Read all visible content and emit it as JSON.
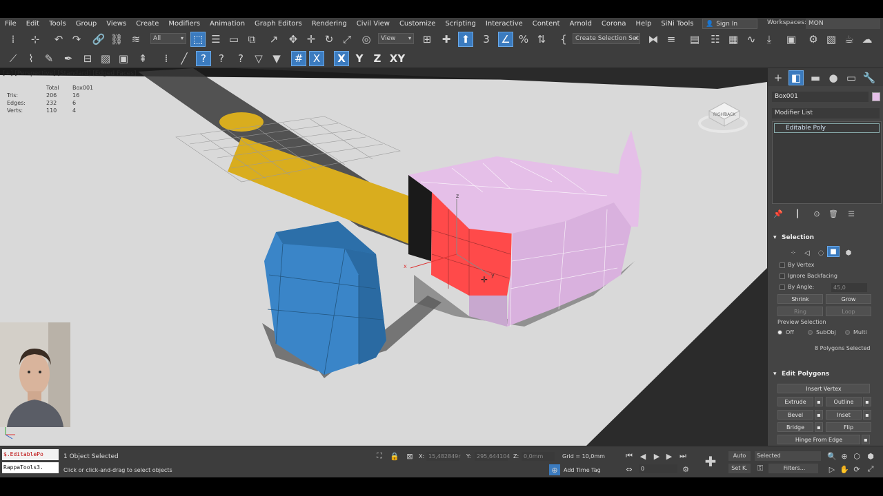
{
  "menubar": {
    "items": [
      "File",
      "Edit",
      "Tools",
      "Group",
      "Views",
      "Create",
      "Modifiers",
      "Animation",
      "Graph Editors",
      "Rendering",
      "Civil View",
      "Customize",
      "Scripting",
      "Interactive",
      "Content",
      "Arnold",
      "Corona",
      "Help",
      "SiNi Tools"
    ],
    "signin_label": "Sign In",
    "workspaces_label": "Workspaces:",
    "workspace_value": "MON"
  },
  "toolbar": {
    "filter_value": "All",
    "refcoord_value": "View",
    "selection_set_value": "Create Selection Set",
    "axis_x": "X",
    "axis_y": "Y",
    "axis_z": "Z",
    "axis_xy": "XY"
  },
  "viewport": {
    "label": "[+] [Perspective] [Standard] [Edged Faces]",
    "stats": {
      "header_total": "Total",
      "header_object": "Box001",
      "rows": [
        {
          "label": "Tris:",
          "total": "206",
          "object": "16"
        },
        {
          "label": "Edges:",
          "total": "232",
          "object": "6"
        },
        {
          "label": "Verts:",
          "total": "110",
          "object": "4"
        }
      ]
    },
    "gizmo": {
      "z": "z",
      "y": "y",
      "x": "x"
    },
    "viewcube": {
      "front": "BACK",
      "side": "RIGHT"
    }
  },
  "command_panel": {
    "object_name": "Box001",
    "modifier_list_label": "Modifier List",
    "stack_item": "Editable Poly",
    "selection": {
      "title": "Selection",
      "by_vertex": "By Vertex",
      "ignore_backfacing": "Ignore Backfacing",
      "by_angle": "By Angle:",
      "by_angle_value": "45,0",
      "shrink": "Shrink",
      "grow": "Grow",
      "ring": "Ring",
      "loop": "Loop",
      "preview_label": "Preview Selection",
      "preview_off": "Off",
      "preview_subobj": "SubObj",
      "preview_multi": "Multi",
      "selected_count": "8 Polygons Selected"
    },
    "edit_polygons": {
      "title": "Edit Polygons",
      "insert_vertex": "Insert Vertex",
      "extrude": "Extrude",
      "outline": "Outline",
      "bevel": "Bevel",
      "inset": "Inset",
      "bridge": "Bridge",
      "flip": "Flip",
      "hinge": "Hinge From Edge"
    }
  },
  "statusbar": {
    "maxscript_1": "$.EditablePo",
    "maxscript_2": "RappaTools3.",
    "objects_selected": "1 Object Selected",
    "prompt": "Click or click-and-drag to select objects",
    "x_label": "X:",
    "x_value": "15,482849r",
    "y_label": "Y:",
    "y_value": "295,644104",
    "z_label": "Z:",
    "z_value": "0,0mm",
    "grid": "Grid = 10,0mm",
    "add_time_tag": "Add Time Tag",
    "auto": "Auto",
    "selected_drop": "Selected",
    "frame": "0",
    "set_key": "Set K.",
    "filters": "Filters..."
  },
  "colors": {
    "selection_red": "#ff4a4a",
    "hammer_pink": "#e5bfe8",
    "cylinder_blue": "#3a85c8",
    "handle_yellow": "#e2b21a",
    "accent_blue": "#3b7bbf"
  }
}
